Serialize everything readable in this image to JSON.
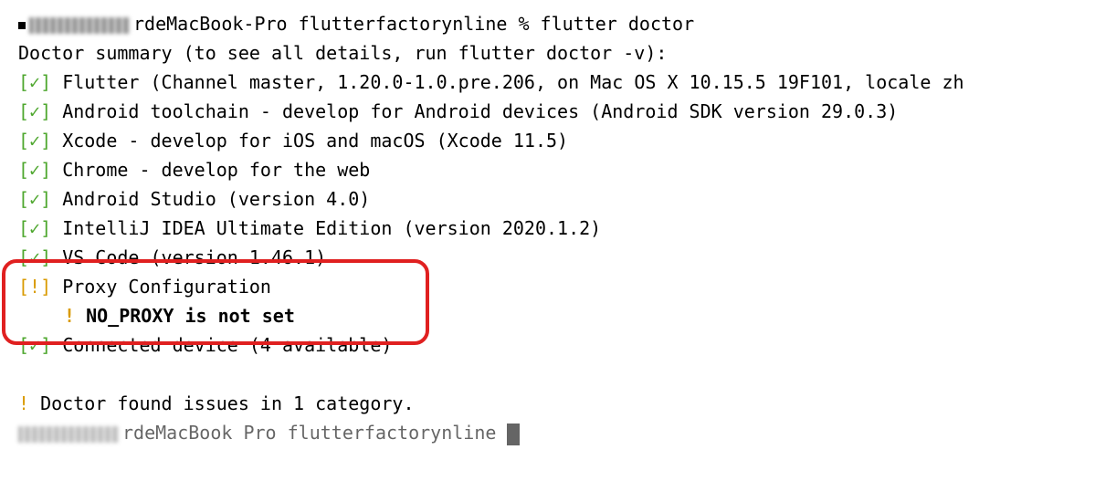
{
  "prompt": {
    "host_suffix": "rdeMacBook-Pro",
    "dir": "flutterfactorynline",
    "symbol": "%",
    "command": "flutter doctor"
  },
  "summary_line": "Doctor summary (to see all details, run flutter doctor -v):",
  "checks": [
    {
      "status": "ok",
      "text": "Flutter (Channel master, 1.20.0-1.0.pre.206, on Mac OS X 10.15.5 19F101, locale zh"
    },
    {
      "status": "ok",
      "text": "Android toolchain - develop for Android devices (Android SDK version 29.0.3)"
    },
    {
      "status": "ok",
      "text": "Xcode - develop for iOS and macOS (Xcode 11.5)"
    },
    {
      "status": "ok",
      "text": "Chrome - develop for the web"
    },
    {
      "status": "ok",
      "text": "Android Studio (version 4.0)"
    },
    {
      "status": "ok",
      "text": "IntelliJ IDEA Ultimate Edition (version 2020.1.2)"
    },
    {
      "status": "ok",
      "text": "VS Code (version 1.46.1)"
    },
    {
      "status": "warn",
      "text": "Proxy Configuration",
      "sub": {
        "marker": "!",
        "text": "NO_PROXY is not set"
      }
    },
    {
      "status": "ok",
      "text": "Connected device (4 available)"
    }
  ],
  "footer": {
    "marker": "!",
    "text": "Doctor found issues in 1 category."
  },
  "trailing_partial": "rdeMacBook Pro flutterfactorynline",
  "markers": {
    "ok_open": "[",
    "ok_check": "✓",
    "ok_close": "]",
    "warn_open": "[",
    "warn_bang": "!",
    "warn_close": "]"
  }
}
